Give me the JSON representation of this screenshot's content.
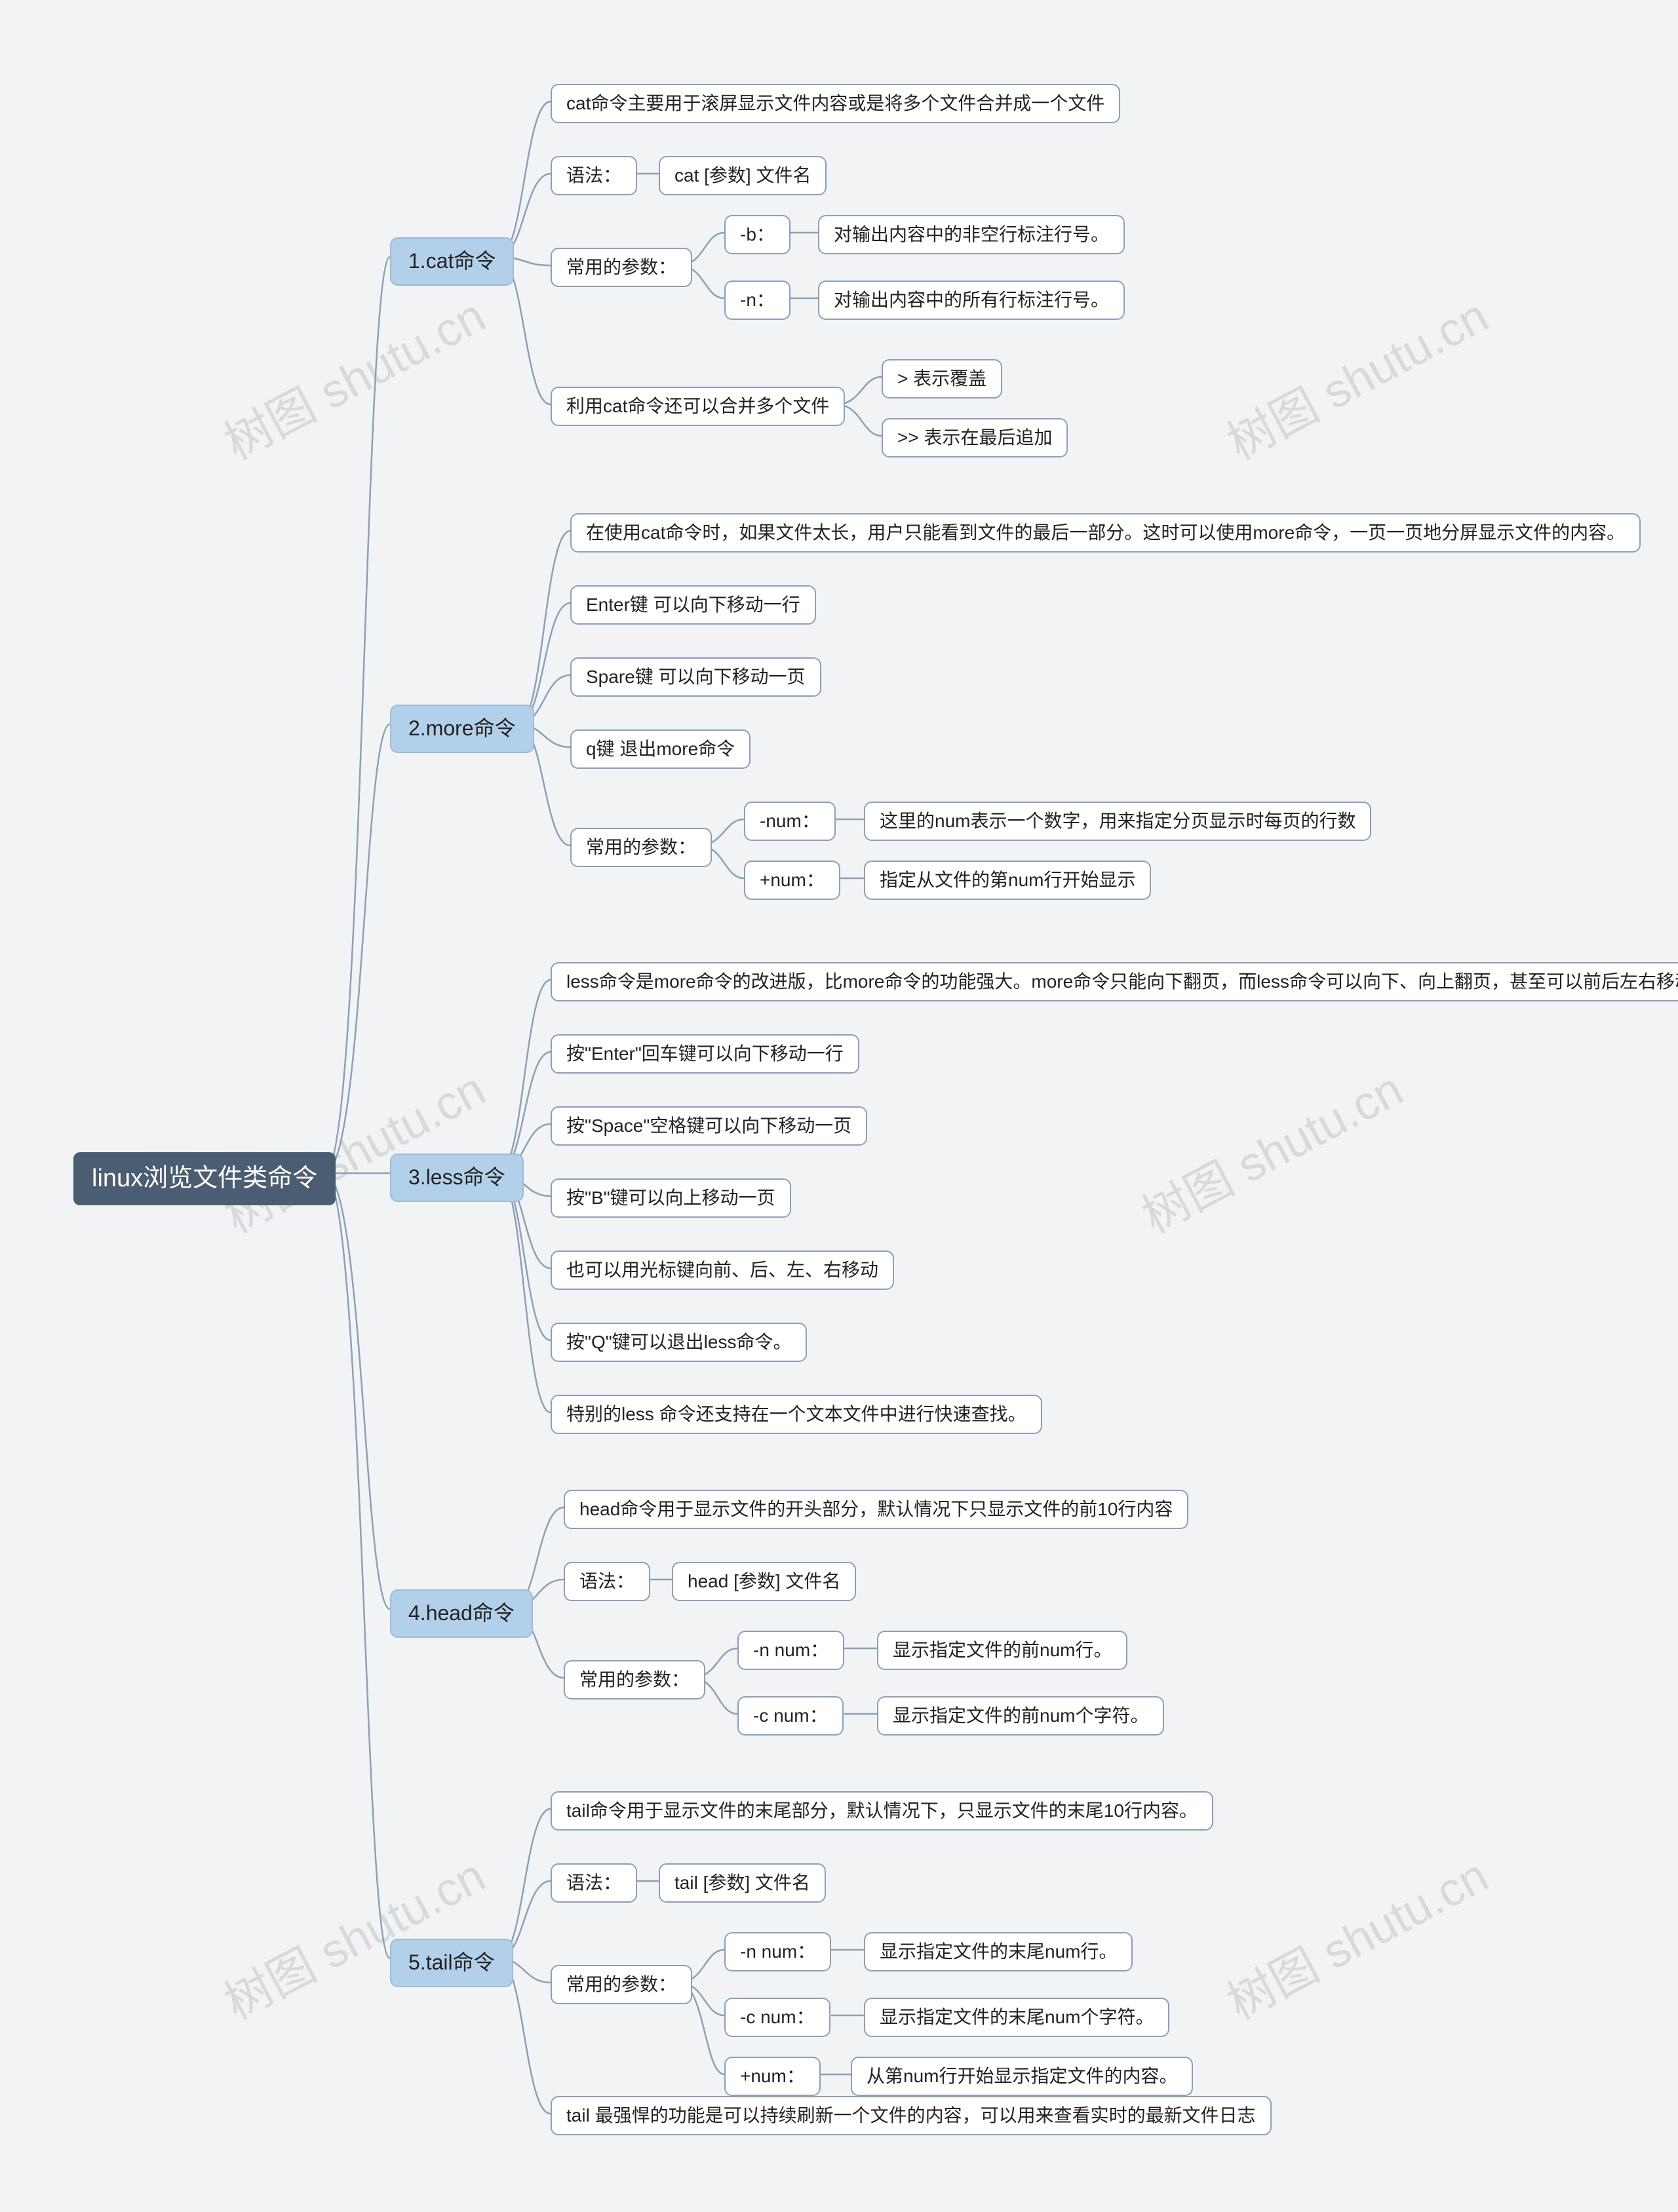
{
  "watermark": "树图 shutu.cn",
  "root": {
    "label": "linux浏览文件类命令"
  },
  "branches": {
    "cat": {
      "label": "1.cat命令"
    },
    "more": {
      "label": "2.more命令"
    },
    "less": {
      "label": "3.less命令"
    },
    "head": {
      "label": "4.head命令"
    },
    "tail": {
      "label": "5.tail命令"
    }
  },
  "leaves": {
    "cat_desc": "cat命令主要用于滚屏显示文件内容或是将多个文件合并成一个文件",
    "cat_syntax_label": "语法：",
    "cat_syntax_value": "cat [参数] 文件名",
    "cat_params_label": "常用的参数：",
    "cat_param_b": "-b：",
    "cat_param_b_desc": "对输出内容中的非空行标注行号。",
    "cat_param_n": "-n：",
    "cat_param_n_desc": "对输出内容中的所有行标注行号。",
    "cat_merge": "利用cat命令还可以合并多个文件",
    "cat_merge_1": "> 表示覆盖",
    "cat_merge_2": ">> 表示在最后追加",
    "more_desc": "在使用cat命令时，如果文件太长，用户只能看到文件的最后一部分。这时可以使用more命令，一页一页地分屏显示文件的内容。",
    "more_enter": "Enter键 可以向下移动一行",
    "more_space": "Spare键 可以向下移动一页",
    "more_q": "q键 退出more命令",
    "more_params_label": "常用的参数：",
    "more_param_num": "-num：",
    "more_param_num_desc": "这里的num表示一个数字，用来指定分页显示时每页的行数",
    "more_param_plus": "+num：",
    "more_param_plus_desc": "指定从文件的第num行开始显示",
    "less_desc": "less命令是more命令的改进版，比more命令的功能强大。more命令只能向下翻页，而less命令可以向下、向上翻页，甚至可以前后左右移动。",
    "less_enter": "按\"Enter\"回车键可以向下移动一行",
    "less_space": "按\"Space\"空格键可以向下移动一页",
    "less_b": "按\"B\"键可以向上移动一页",
    "less_cursor": "也可以用光标键向前、后、左、右移动",
    "less_q": "按\"Q\"键可以退出less命令。",
    "less_search": "特别的less 命令还支持在一个文本文件中进行快速查找。",
    "head_desc": "head命令用于显示文件的开头部分，默认情况下只显示文件的前10行内容",
    "head_syntax_label": "语法：",
    "head_syntax_value": "head [参数] 文件名",
    "head_params_label": "常用的参数：",
    "head_param_n": "-n num：",
    "head_param_n_desc": "显示指定文件的前num行。",
    "head_param_c": "-c num：",
    "head_param_c_desc": "显示指定文件的前num个字符。",
    "tail_desc": "tail命令用于显示文件的末尾部分，默认情况下，只显示文件的末尾10行内容。",
    "tail_syntax_label": "语法：",
    "tail_syntax_value": "tail [参数] 文件名",
    "tail_params_label": "常用的参数：",
    "tail_param_n": "-n num：",
    "tail_param_n_desc": "显示指定文件的末尾num行。",
    "tail_param_c": "-c num：",
    "tail_param_c_desc": "显示指定文件的末尾num个字符。",
    "tail_param_plus": "+num：",
    "tail_param_plus_desc": "从第num行开始显示指定文件的内容。",
    "tail_follow": "tail 最强悍的功能是可以持续刷新一个文件的内容，可以用来查看实时的最新文件日志"
  }
}
